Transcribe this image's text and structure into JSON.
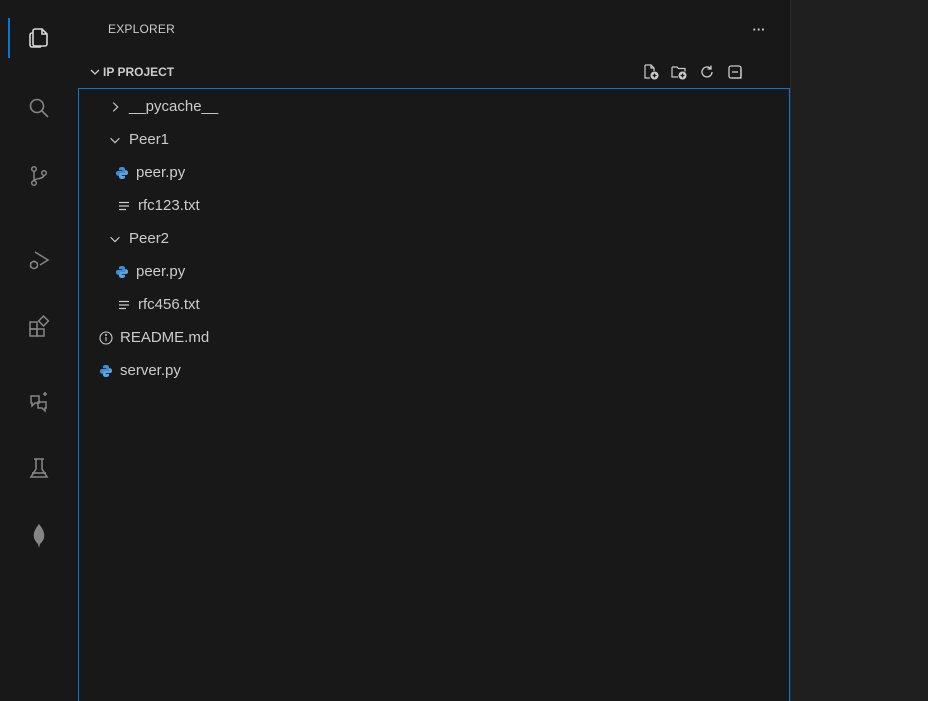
{
  "explorer": {
    "title": "EXPLORER",
    "more_label": "···"
  },
  "section": {
    "title": "IP PROJECT",
    "actions": [
      "new-file-icon",
      "new-folder-icon",
      "refresh-icon",
      "collapse-all-icon"
    ]
  },
  "activity_bar": [
    "explorer-icon",
    "search-icon",
    "source-control-icon",
    "run-debug-icon",
    "extensions-icon",
    "chat-icon",
    "testing-icon",
    "mongodb-leaf-icon"
  ],
  "tree": [
    {
      "label": "__pycache__",
      "type": "folder",
      "expanded": false,
      "depth": 0
    },
    {
      "label": "Peer1",
      "type": "folder",
      "expanded": true,
      "depth": 0
    },
    {
      "label": "peer.py",
      "type": "python",
      "depth": 1
    },
    {
      "label": "rfc123.txt",
      "type": "text",
      "depth": 1
    },
    {
      "label": "Peer2",
      "type": "folder",
      "expanded": true,
      "depth": 0
    },
    {
      "label": "peer.py",
      "type": "python",
      "depth": 1
    },
    {
      "label": "rfc456.txt",
      "type": "text",
      "depth": 1
    },
    {
      "label": "README.md",
      "type": "info",
      "depth": 0
    },
    {
      "label": "server.py",
      "type": "python",
      "depth": 0
    }
  ],
  "colors": {
    "accent": "#0078d4",
    "python": "#3c8fd6",
    "sidebar_bg": "#181818",
    "editor_bg": "#1f1f1f"
  }
}
